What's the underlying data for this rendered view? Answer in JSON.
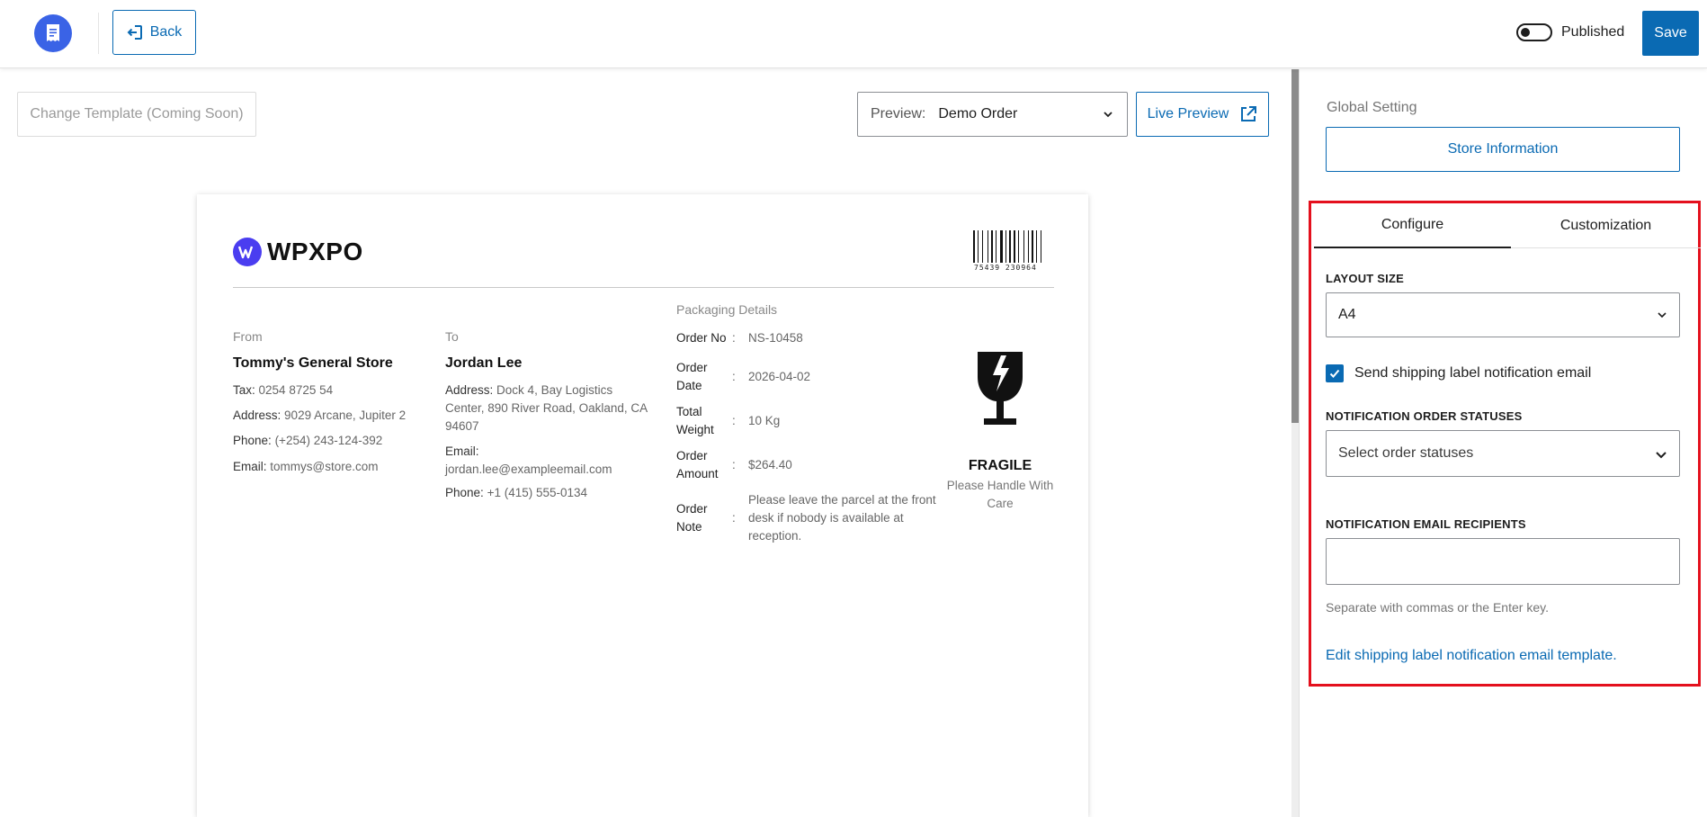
{
  "header": {
    "logo_icon": "document-icon",
    "back_label": "Back",
    "published_label": "Published",
    "published_state": false,
    "save_label": "Save",
    "accent_color": "#0a6ab3"
  },
  "toolbar": {
    "change_template_label": "Change Template (Coming Soon)",
    "preview_label": "Preview:",
    "preview_value": "Demo Order",
    "live_preview_label": "Live Preview"
  },
  "label_doc": {
    "brand_name": "WPXPO",
    "barcode_number": "75439   230964",
    "from": {
      "section_label": "From",
      "name": "Tommy's General Store",
      "tax_key": "Tax:",
      "tax_val": "0254 8725 54",
      "address_key": "Address:",
      "address_val": "9029 Arcane, Jupiter 2",
      "phone_key": "Phone:",
      "phone_val": "(+254) 243-124-392",
      "email_key": "Email:",
      "email_val": "tommys@store.com"
    },
    "to": {
      "section_label": "To",
      "name": "Jordan Lee",
      "address_key": "Address:",
      "address_val": "Dock 4, Bay Logistics Center, 890 River Road, Oakland, CA 94607",
      "email_key": "Email:",
      "email_val": "jordan.lee@exampleemail.com",
      "phone_key": "Phone:",
      "phone_val": "+1 (415) 555-0134"
    },
    "packaging": {
      "title": "Packaging Details",
      "rows": [
        {
          "key": "Order No",
          "val": "NS-10458"
        },
        {
          "key": "Order Date",
          "val": "2026-04-02"
        },
        {
          "key": "Total Weight",
          "val": "10 Kg"
        },
        {
          "key": "Order Amount",
          "val": "$264.40"
        },
        {
          "key": "Order Note",
          "val": "Please leave the parcel at the front desk if nobody is available at reception."
        }
      ]
    },
    "fragile": {
      "icon": "fragile-glass-icon",
      "title": "FRAGILE",
      "subtitle": "Please Handle With Care"
    }
  },
  "sidebar": {
    "global_label": "Global Setting",
    "store_info_label": "Store Information",
    "tabs": [
      {
        "label": "Configure",
        "active": true
      },
      {
        "label": "Customization",
        "active": false
      }
    ],
    "layout_size_label": "LAYOUT SIZE",
    "layout_size_value": "A4",
    "notify_checkbox_label": "Send shipping label notification email",
    "notify_checked": true,
    "statuses_label": "NOTIFICATION ORDER STATUSES",
    "statuses_placeholder": "Select order statuses",
    "recipients_label": "NOTIFICATION EMAIL RECIPIENTS",
    "recipients_value": "",
    "recipients_hint": "Separate with commas or the Enter key.",
    "edit_template_link": "Edit shipping label notification email template.",
    "highlight_color": "#e4101d"
  }
}
